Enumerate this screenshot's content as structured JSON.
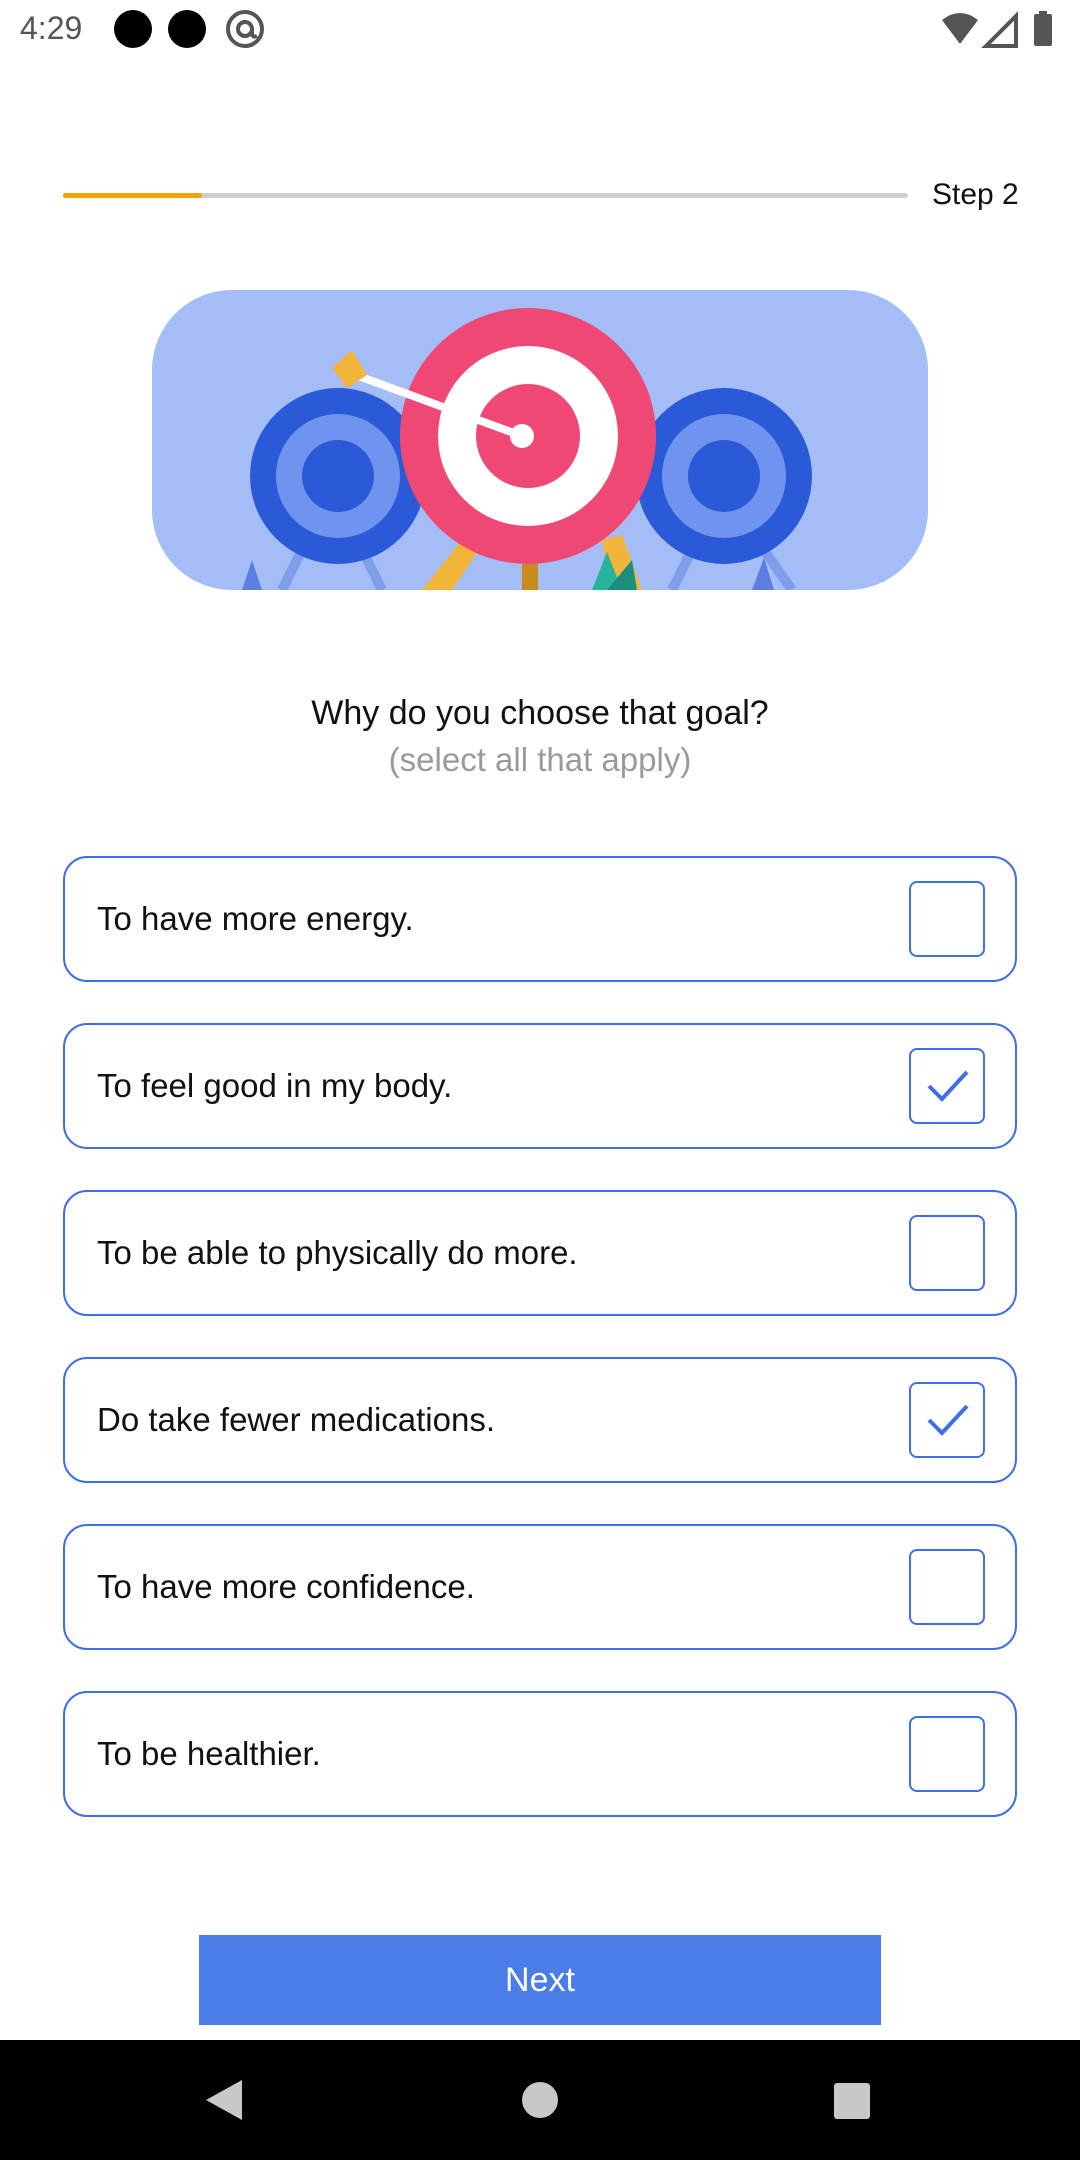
{
  "status_bar": {
    "time": "4:29",
    "icons": [
      "notification-dot-icon",
      "notification-dot-icon",
      "at-sign-icon",
      "wifi-icon",
      "signal-icon",
      "battery-icon"
    ]
  },
  "progress": {
    "step_label": "Step 2",
    "fraction": 0.165,
    "color": "#f5a300"
  },
  "illustration": {
    "icon": "target-arrow-illustration"
  },
  "question": {
    "title": "Why do you choose that goal?",
    "hint": "(select all that apply)"
  },
  "options": [
    {
      "label": "To have more energy.",
      "checked": false
    },
    {
      "label": "To feel good in my body.",
      "checked": true
    },
    {
      "label": "To be able to physically do more.",
      "checked": false
    },
    {
      "label": "Do take fewer medications.",
      "checked": true
    },
    {
      "label": "To have more confidence.",
      "checked": false
    },
    {
      "label": "To be healthier.",
      "checked": false
    }
  ],
  "next_button": {
    "label": "Next"
  },
  "navigation": {
    "icons": [
      "back-icon",
      "home-icon",
      "recents-icon"
    ]
  },
  "colors": {
    "accent": "#3f6ee6",
    "button": "#4a7de8",
    "hero_bg": "#a4bdf6"
  }
}
